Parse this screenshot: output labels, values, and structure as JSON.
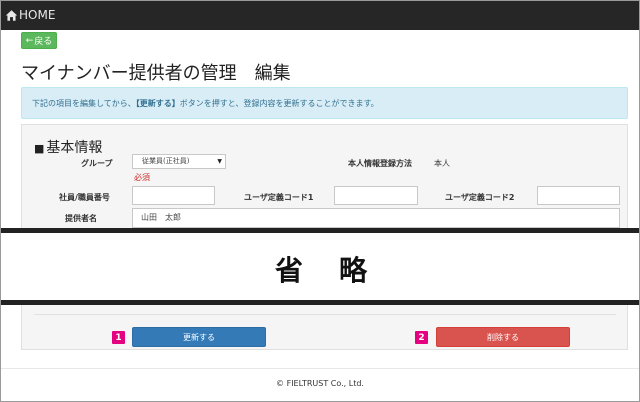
{
  "nav": {
    "home_label": "HOME"
  },
  "back_label": "戻る",
  "page_title": "マイナンバー提供者の管理　編集",
  "info": {
    "before": "下記の項目を編集してから、",
    "bold": "【更新する】",
    "after": "ボタンを押すと、登録内容を更新することができます。"
  },
  "section_title": "基本情報",
  "form": {
    "group_label": "グループ",
    "group_value": "従業員(正社員)",
    "required_text": "必須",
    "reg_method_label": "本人情報登録方法",
    "reg_method_value": "本人",
    "employee_no_label": "社員/職員番号",
    "employee_no_value": "",
    "user_code1_label": "ユーザ定義コード1",
    "user_code1_value": "",
    "user_code2_label": "ユーザ定義コード2",
    "user_code2_value": "",
    "provider_name_label": "提供者名",
    "provider_name_value": "山田　太郎"
  },
  "omitted_text": "省略",
  "badges": {
    "one": "1",
    "two": "2"
  },
  "buttons": {
    "update": "更新する",
    "delete": "削除する"
  },
  "footer": {
    "copyright": "© FIELTRUST Co., Ltd."
  },
  "colors": {
    "topbar": "#262626",
    "back_button": "#5cb85c",
    "info_bg": "#d9edf7",
    "info_text": "#31708f",
    "update_button": "#337ab7",
    "delete_button": "#d9534f",
    "badge": "#e5007f",
    "required": "#c9302c"
  }
}
